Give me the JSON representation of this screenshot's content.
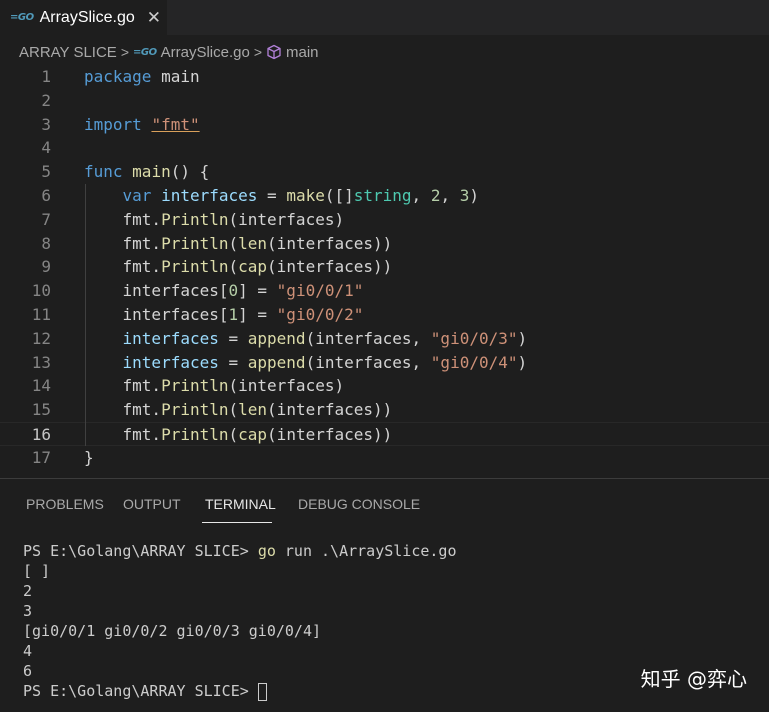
{
  "tab": {
    "icon": "go-file-icon",
    "label": "ArraySlice.go",
    "close": "✕"
  },
  "breadcrumb": {
    "folder": "ARRAY SLICE",
    "file": "ArraySlice.go",
    "symbol": "main",
    "separator": ">"
  },
  "editor": {
    "current_line": 16,
    "lines": [
      {
        "n": "1"
      },
      {
        "n": "2"
      },
      {
        "n": "3"
      },
      {
        "n": "4"
      },
      {
        "n": "5"
      },
      {
        "n": "6"
      },
      {
        "n": "7"
      },
      {
        "n": "8"
      },
      {
        "n": "9"
      },
      {
        "n": "10"
      },
      {
        "n": "11"
      },
      {
        "n": "12"
      },
      {
        "n": "13"
      },
      {
        "n": "14"
      },
      {
        "n": "15"
      },
      {
        "n": "16"
      },
      {
        "n": "17"
      }
    ],
    "code": [
      [
        [
          "kw",
          "package"
        ],
        [
          "pl",
          " main"
        ]
      ],
      [],
      [
        [
          "kw",
          "import"
        ],
        [
          "pl",
          " "
        ],
        [
          "str ul",
          "\"fmt\""
        ]
      ],
      [],
      [
        [
          "kw",
          "func"
        ],
        [
          "pl",
          " "
        ],
        [
          "fn",
          "main"
        ],
        [
          "pl",
          "() {"
        ]
      ],
      [
        [
          "pl",
          "    "
        ],
        [
          "kw",
          "var"
        ],
        [
          "pl",
          " "
        ],
        [
          "var",
          "interfaces"
        ],
        [
          "pl",
          " = "
        ],
        [
          "fn",
          "make"
        ],
        [
          "pl",
          "([]"
        ],
        [
          "typ",
          "string"
        ],
        [
          "pl",
          ", "
        ],
        [
          "num",
          "2"
        ],
        [
          "pl",
          ", "
        ],
        [
          "num",
          "3"
        ],
        [
          "pl",
          ")"
        ]
      ],
      [
        [
          "pl",
          "    fmt."
        ],
        [
          "fn",
          "Println"
        ],
        [
          "pl",
          "(interfaces)"
        ]
      ],
      [
        [
          "pl",
          "    fmt."
        ],
        [
          "fn",
          "Println"
        ],
        [
          "pl",
          "("
        ],
        [
          "fn",
          "len"
        ],
        [
          "pl",
          "(interfaces))"
        ]
      ],
      [
        [
          "pl",
          "    fmt."
        ],
        [
          "fn",
          "Println"
        ],
        [
          "pl",
          "("
        ],
        [
          "fn",
          "cap"
        ],
        [
          "pl",
          "(interfaces))"
        ]
      ],
      [
        [
          "pl",
          "    interfaces["
        ],
        [
          "num",
          "0"
        ],
        [
          "pl",
          "] = "
        ],
        [
          "str",
          "\"gi0/0/1\""
        ]
      ],
      [
        [
          "pl",
          "    interfaces["
        ],
        [
          "num",
          "1"
        ],
        [
          "pl",
          "] = "
        ],
        [
          "str",
          "\"gi0/0/2\""
        ]
      ],
      [
        [
          "pl",
          "    "
        ],
        [
          "var",
          "interfaces"
        ],
        [
          "pl",
          " = "
        ],
        [
          "fn",
          "append"
        ],
        [
          "pl",
          "(interfaces, "
        ],
        [
          "str",
          "\"gi0/0/3\""
        ],
        [
          "pl",
          ")"
        ]
      ],
      [
        [
          "pl",
          "    "
        ],
        [
          "var",
          "interfaces"
        ],
        [
          "pl",
          " = "
        ],
        [
          "fn",
          "append"
        ],
        [
          "pl",
          "(interfaces, "
        ],
        [
          "str",
          "\"gi0/0/4\""
        ],
        [
          "pl",
          ")"
        ]
      ],
      [
        [
          "pl",
          "    fmt."
        ],
        [
          "fn",
          "Println"
        ],
        [
          "pl",
          "(interfaces)"
        ]
      ],
      [
        [
          "pl",
          "    fmt."
        ],
        [
          "fn",
          "Println"
        ],
        [
          "pl",
          "("
        ],
        [
          "fn",
          "len"
        ],
        [
          "pl",
          "(interfaces))"
        ]
      ],
      [
        [
          "pl",
          "    fmt."
        ],
        [
          "fn",
          "Println"
        ],
        [
          "pl",
          "("
        ],
        [
          "fn",
          "cap"
        ],
        [
          "pl",
          "(interfaces))"
        ]
      ],
      [
        [
          "pl",
          "}"
        ]
      ]
    ]
  },
  "panel": {
    "tabs": [
      "PROBLEMS",
      "OUTPUT",
      "TERMINAL",
      "DEBUG CONSOLE"
    ],
    "active_tab": "TERMINAL"
  },
  "terminal": {
    "prompt": "PS E:\\Golang\\ARRAY SLICE> ",
    "command_go": "go",
    "command_rest": " run .\\ArraySlice.go",
    "output": [
      "[ ]",
      "2",
      "3",
      "[gi0/0/1 gi0/0/2 gi0/0/3 gi0/0/4]",
      "4",
      "6"
    ],
    "final_prompt": "PS E:\\Golang\\ARRAY SLICE> "
  },
  "watermark": "知乎 @弈心"
}
